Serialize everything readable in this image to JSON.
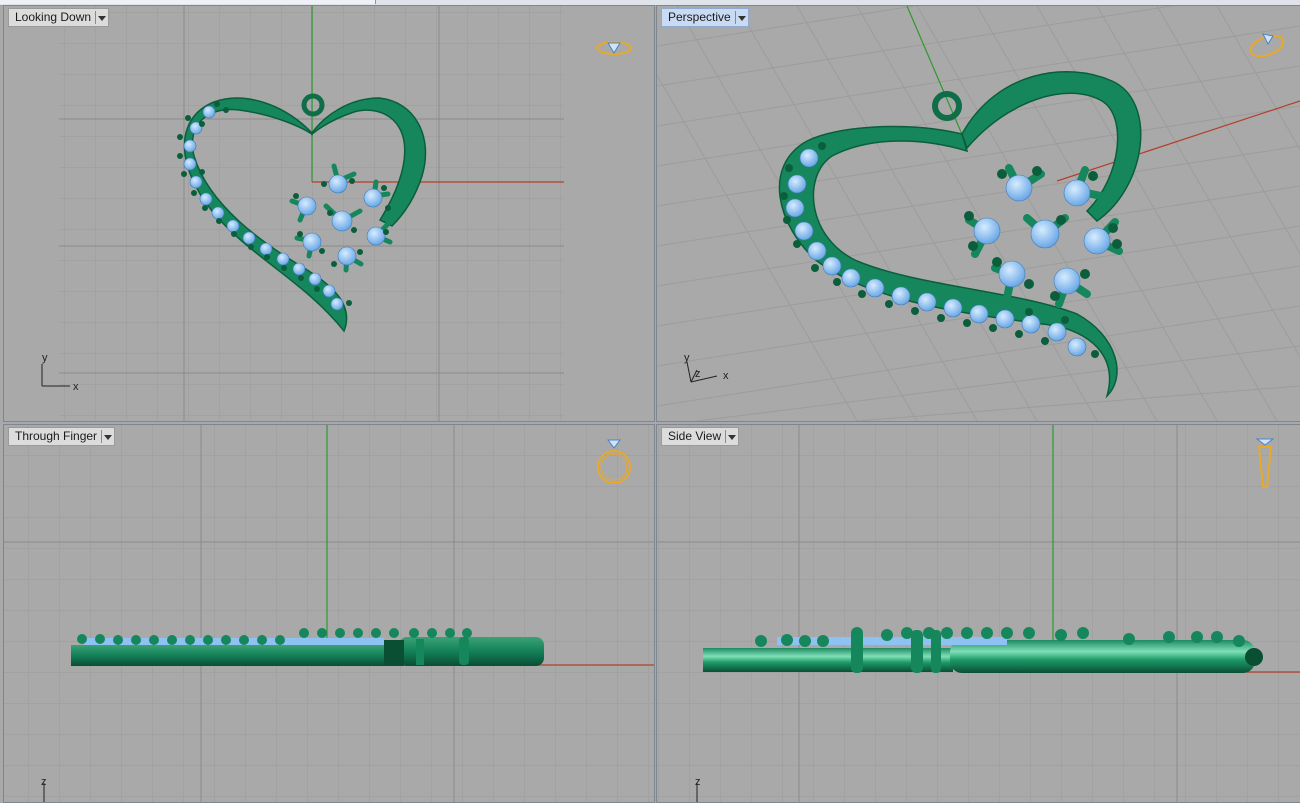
{
  "viewports": {
    "top": {
      "label": "Looking Down",
      "axes": [
        "y",
        "x"
      ]
    },
    "perspective": {
      "label": "Perspective",
      "axes": [
        "y",
        "z",
        "x"
      ]
    },
    "front": {
      "label": "Through Finger",
      "axes": [
        "z"
      ]
    },
    "right": {
      "label": "Side View",
      "axes": [
        "z"
      ]
    }
  },
  "icons": {
    "top": "ring-top-view-icon",
    "perspective": "ring-perspective-icon",
    "front": "ring-front-view-icon",
    "right": "ring-side-view-icon"
  },
  "colors": {
    "metal": "#12845a",
    "gem": "#8ec2f2",
    "background": "#a9a9a9",
    "grid": "#9b9b9b",
    "x_axis": "#b3402c",
    "y_axis": "#2e9a2e",
    "icon": "#e8a92a",
    "active_label": "#c9dbf3"
  }
}
